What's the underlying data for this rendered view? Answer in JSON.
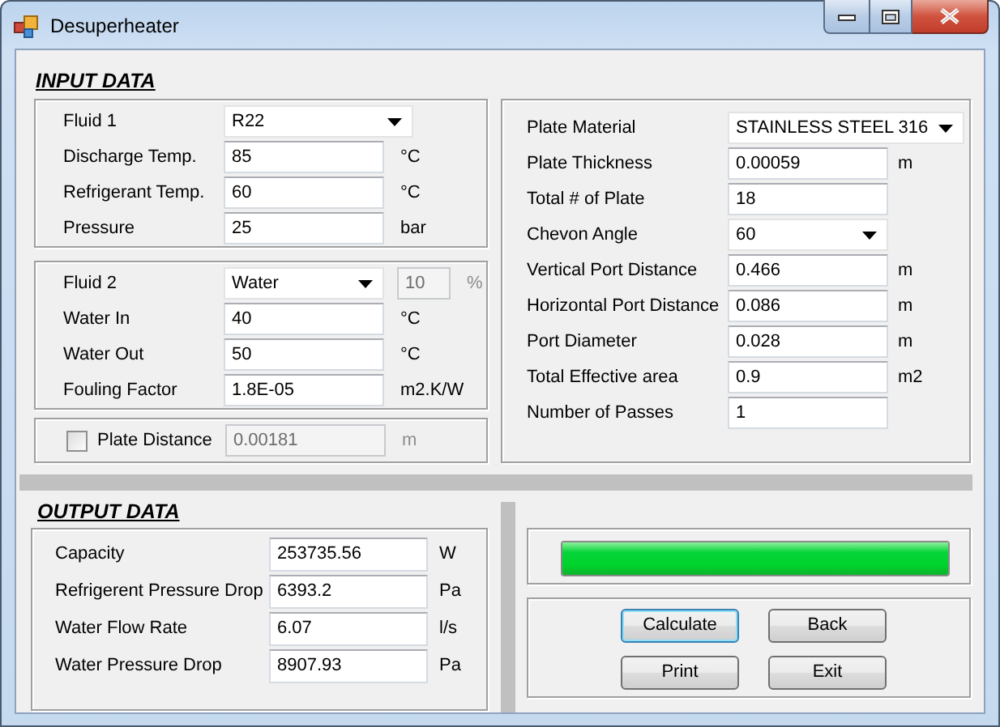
{
  "window": {
    "title": "Desuperheater"
  },
  "input_data": {
    "heading": "INPUT DATA",
    "fluid_1": [
      {
        "kind": "combo-wide",
        "label": "Fluid 1",
        "value": "R22"
      },
      {
        "kind": "field",
        "label": "Discharge Temp.",
        "value": "85",
        "unit": "°C"
      },
      {
        "kind": "field",
        "label": "Refrigerant Temp.",
        "value": "60",
        "unit": "°C"
      },
      {
        "kind": "field",
        "label": "Pressure",
        "value": "25",
        "unit": "bar"
      }
    ],
    "fluid_2": [
      {
        "kind": "combo",
        "label": "Fluid 2",
        "value": "Water",
        "extra": {
          "value": "10",
          "unit": "%",
          "disabled": true
        }
      },
      {
        "kind": "field",
        "label": "Water In",
        "value": "40",
        "unit": "°C"
      },
      {
        "kind": "field",
        "label": "Water Out",
        "value": "50",
        "unit": "°C"
      },
      {
        "kind": "field",
        "label": "Fouling Factor",
        "value": "1.8E-05",
        "unit": "m2.K/W"
      }
    ],
    "plate_distance": [
      {
        "kind": "check-field",
        "label": "Plate Distance",
        "checked": false,
        "value": "0.00181",
        "unit": "m",
        "disabled": true
      }
    ],
    "plate": [
      {
        "kind": "combo-wide",
        "label": "Plate Material",
        "value": "STAINLESS STEEL 316"
      },
      {
        "kind": "field",
        "label": "Plate Thickness",
        "value": "0.00059",
        "unit": "m"
      },
      {
        "kind": "field",
        "label": "Total # of Plate",
        "value": "18"
      },
      {
        "kind": "combo",
        "label": "Chevon Angle",
        "value": "60"
      },
      {
        "kind": "field",
        "label": "Vertical Port Distance",
        "value": "0.466",
        "unit": "m"
      },
      {
        "kind": "field",
        "label": "Horizontal Port Distance",
        "value": "0.086",
        "unit": "m"
      },
      {
        "kind": "field",
        "label": "Port Diameter",
        "value": "0.028",
        "unit": "m"
      },
      {
        "kind": "field",
        "label": "Total Effective area",
        "value": "0.9",
        "unit": "m2"
      },
      {
        "kind": "field",
        "label": "Number of Passes",
        "value": "1"
      }
    ]
  },
  "output_data": {
    "heading": "OUTPUT DATA",
    "rows": [
      {
        "kind": "field",
        "label": "Capacity",
        "value": "253735.56",
        "unit": "W"
      },
      {
        "kind": "field",
        "label": "Refrigerent Pressure Drop",
        "value": "6393.2",
        "unit": "Pa"
      },
      {
        "kind": "field",
        "label": "Water Flow Rate",
        "value": "6.07",
        "unit": "l/s"
      },
      {
        "kind": "field",
        "label": "Water Pressure Drop",
        "value": "8907.93",
        "unit": "Pa"
      }
    ]
  },
  "progress": {
    "level": 1
  },
  "buttons": [
    {
      "label": "Calculate",
      "focused": true
    },
    {
      "label": "Back",
      "focused": false
    },
    {
      "label": "Print",
      "focused": false
    },
    {
      "label": "Exit",
      "focused": false
    }
  ]
}
